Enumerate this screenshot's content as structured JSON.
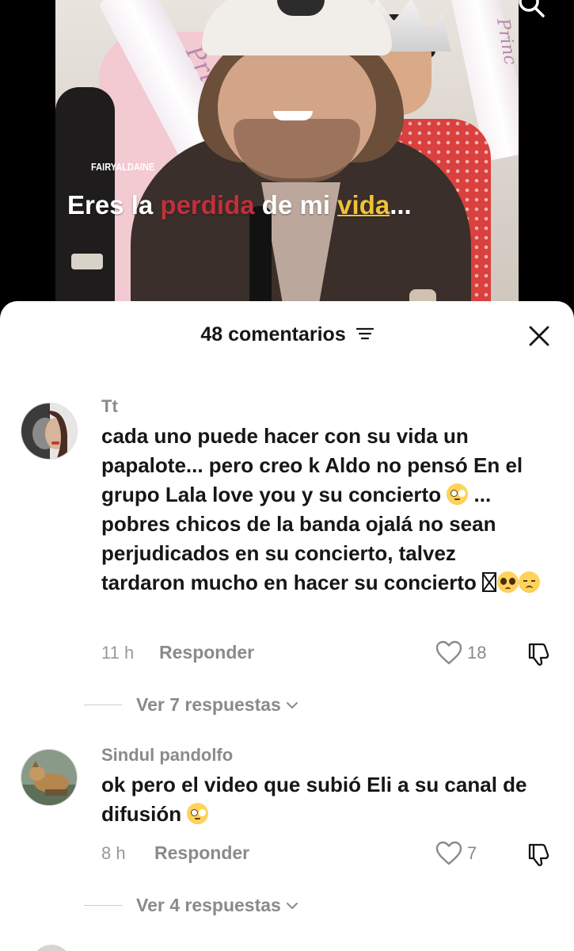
{
  "video": {
    "watermark": "FAIRYALDAINE",
    "sash_left_text": "Princ",
    "sash_right_text": "Princ",
    "caption": {
      "word1": "Eres la",
      "word2": "perdida",
      "word3": "de mi",
      "word4": "vida",
      "word5": "..."
    },
    "search_icon": "search-icon"
  },
  "sheet": {
    "title": "48 comentarios",
    "sort_icon": "sort-icon",
    "close_icon": "close-icon"
  },
  "comments": [
    {
      "username": "Tt",
      "text_before": "cada uno puede hacer con su vida un papalote... pero creo k Aldo no pensó En el grupo Lala love you y su concierto ",
      "text_middle": " ... pobres chicos de la banda ojalá no sean perjudicados en su concierto, talvez tardaron mucho en hacer su concierto ",
      "emojis": [
        "flushed-emoji",
        "missing-glyph",
        "pleading-emoji",
        "disappointed-emoji"
      ],
      "time": "11 h",
      "reply_label": "Responder",
      "likes": "18",
      "view_replies": "Ver 7 respuestas"
    },
    {
      "username": "Sindul pandolfo",
      "text_before": "ok pero el video que subió Eli a su canal de difusión ",
      "emojis": [
        "flushed-emoji"
      ],
      "time": "8 h",
      "reply_label": "Responder",
      "likes": "7",
      "view_replies": "Ver 4 respuestas"
    }
  ],
  "colors": {
    "caption_red": "#c0303a",
    "caption_yellow": "#f0c23a",
    "muted_text": "#8a8a8a",
    "primary_text": "#161616"
  }
}
